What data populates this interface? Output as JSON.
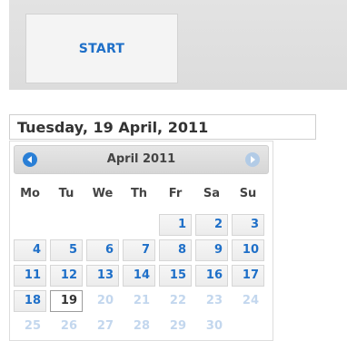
{
  "start_button": {
    "label": "START"
  },
  "date_field": {
    "value": "Tuesday, 19 April, 2011"
  },
  "datepicker": {
    "month_title": "April 2011",
    "prev_icon": "chevron-left-icon",
    "next_icon": "chevron-right-icon",
    "weekdays": [
      "Mo",
      "Tu",
      "We",
      "Th",
      "Fr",
      "Sa",
      "Su"
    ],
    "weeks": [
      [
        "",
        "",
        "",
        "",
        "1",
        "2",
        "3"
      ],
      [
        "4",
        "5",
        "6",
        "7",
        "8",
        "9",
        "10"
      ],
      [
        "11",
        "12",
        "13",
        "14",
        "15",
        "16",
        "17"
      ],
      [
        "18",
        "19",
        "20",
        "21",
        "22",
        "23",
        "24"
      ],
      [
        "25",
        "26",
        "27",
        "28",
        "29",
        "30",
        ""
      ]
    ],
    "today": "19",
    "last_selectable": "19"
  },
  "colors": {
    "accent": "#1e6fc8",
    "faded_day": "#c3d7ee",
    "nav_prev": "#2a7fd6",
    "nav_next": "#b2cbe6"
  }
}
